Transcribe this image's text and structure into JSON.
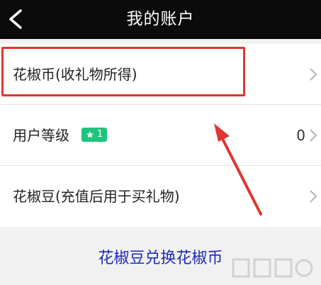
{
  "header": {
    "title": "我的账户"
  },
  "list": {
    "items": [
      {
        "label": "花椒币(收礼物所得)",
        "value": ""
      },
      {
        "label": "用户等级",
        "badge": "1",
        "value": "0"
      },
      {
        "label": "花椒豆(充值后用于买礼物)",
        "value": ""
      }
    ]
  },
  "link": {
    "text": "花椒豆兑换花椒币"
  },
  "colors": {
    "header_bg": "#0b0b0b",
    "annotation_red": "#e0362f",
    "badge_green": "#1fc47c",
    "link_blue": "#1f2bb5"
  },
  "icons": [
    "back-icon",
    "chevron-right-icon",
    "star-icon",
    "arrow-annotation"
  ]
}
